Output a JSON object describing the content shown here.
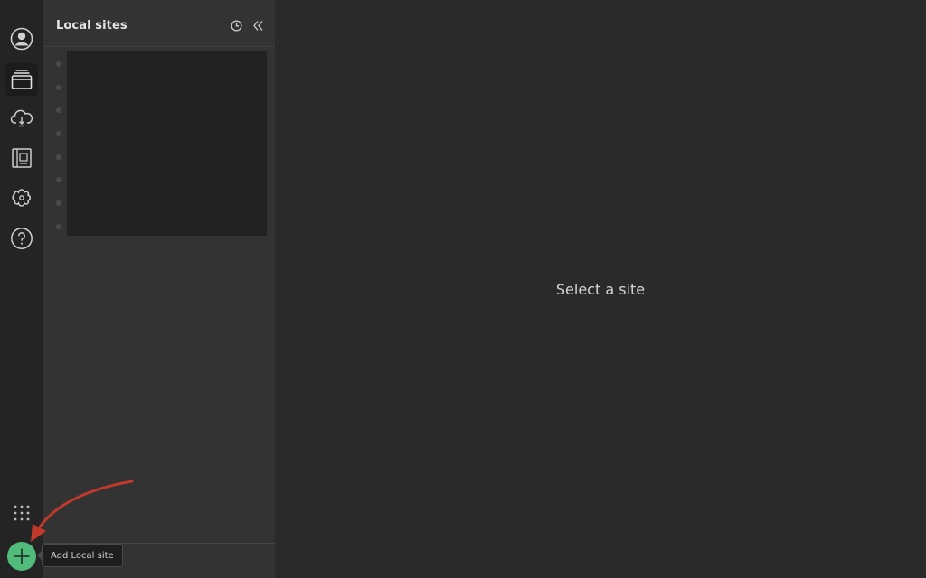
{
  "sidebar": {
    "items": [
      {
        "icon": "user-avatar-icon"
      },
      {
        "icon": "local-sites-icon",
        "active": true
      },
      {
        "icon": "cloud-connect-icon"
      },
      {
        "icon": "blueprints-icon"
      },
      {
        "icon": "add-ons-icon"
      },
      {
        "icon": "help-icon"
      }
    ],
    "apps_icon": "grid-dots-icon",
    "add_button_icon": "plus-icon"
  },
  "panel": {
    "title": "Local sites",
    "history_icon": "clock-icon",
    "collapse_icon": "double-chevron-left-icon"
  },
  "main": {
    "empty_message": "Select a site"
  },
  "tooltip": {
    "label": "Add Local site"
  },
  "colors": {
    "accent": "#51bb7b",
    "annotation_arrow": "#c0392b",
    "background": "#2a2a2a",
    "panel": "#333333",
    "rail": "#242424"
  }
}
